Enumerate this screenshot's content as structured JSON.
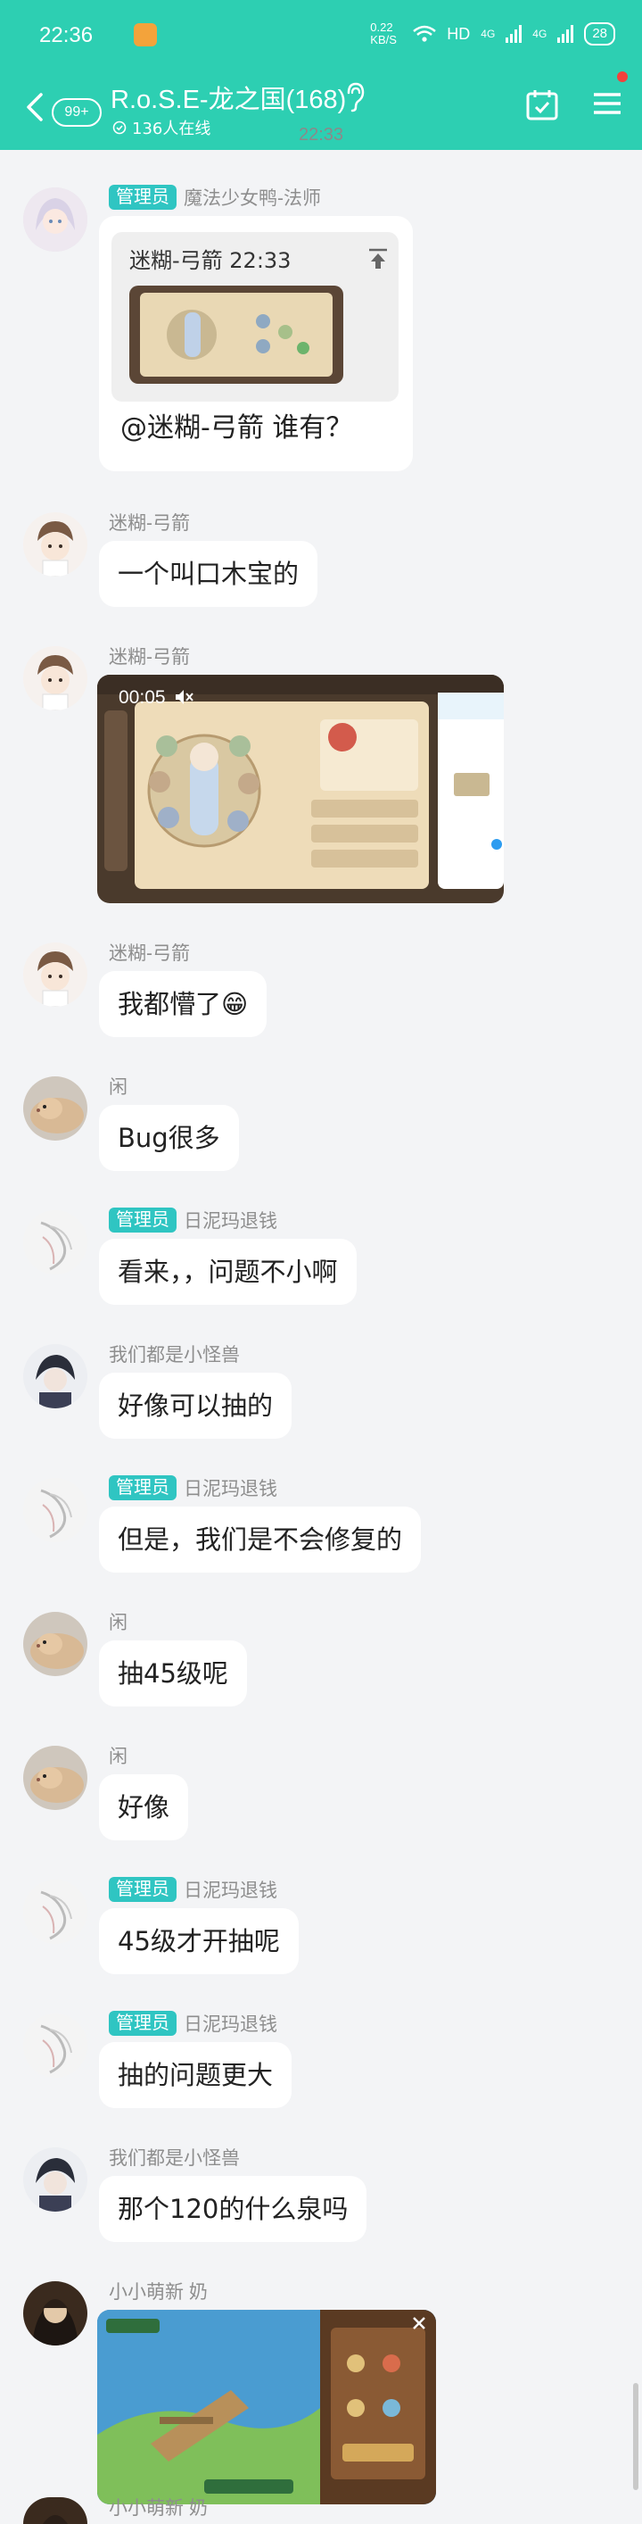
{
  "status_bar": {
    "time": "22:36",
    "speed": "0.22 KB/S",
    "wifi": "HD",
    "signal1": "4G",
    "signal2": "4G",
    "battery": "28"
  },
  "header": {
    "unread": "99+",
    "title": "R.o.S.E-龙之国(168)",
    "online": "136人在线"
  },
  "timestamp": "22:33",
  "messages": [
    {
      "sender": "魔法少女鸭-法师",
      "admin": "管理员",
      "quote_name": "迷糊-弓箭 22:33",
      "text": "@迷糊-弓箭 谁有？"
    },
    {
      "sender": "迷糊-弓箭",
      "text": "一个叫口木宝的"
    },
    {
      "sender": "迷糊-弓箭",
      "video_duration": "00:05"
    },
    {
      "sender": "迷糊-弓箭",
      "text": "我都懵了😁"
    },
    {
      "sender": "闲",
      "text": "Bug很多"
    },
    {
      "sender": "日泥玛退钱",
      "admin": "管理员",
      "text": "看来，，问题不小啊"
    },
    {
      "sender": "我们都是小怪兽",
      "text": "好像可以抽的"
    },
    {
      "sender": "日泥玛退钱",
      "admin": "管理员",
      "text": "但是，我们是不会修复的"
    },
    {
      "sender": "闲",
      "text": "抽45级呢"
    },
    {
      "sender": "闲",
      "text": "好像"
    },
    {
      "sender": "日泥玛退钱",
      "admin": "管理员",
      "text": "45级才开抽呢"
    },
    {
      "sender": "日泥玛退钱",
      "admin": "管理员",
      "text": "抽的问题更大"
    },
    {
      "sender": "我们都是小怪兽",
      "text": "那个120的什么泉吗"
    },
    {
      "sender": "小小萌新 奶"
    },
    {
      "sender": "小小萌新 奶"
    }
  ],
  "colors": {
    "accent": "#2dcfb2",
    "admin_tag": "#2fc5c2",
    "background": "#f3f4f6"
  }
}
